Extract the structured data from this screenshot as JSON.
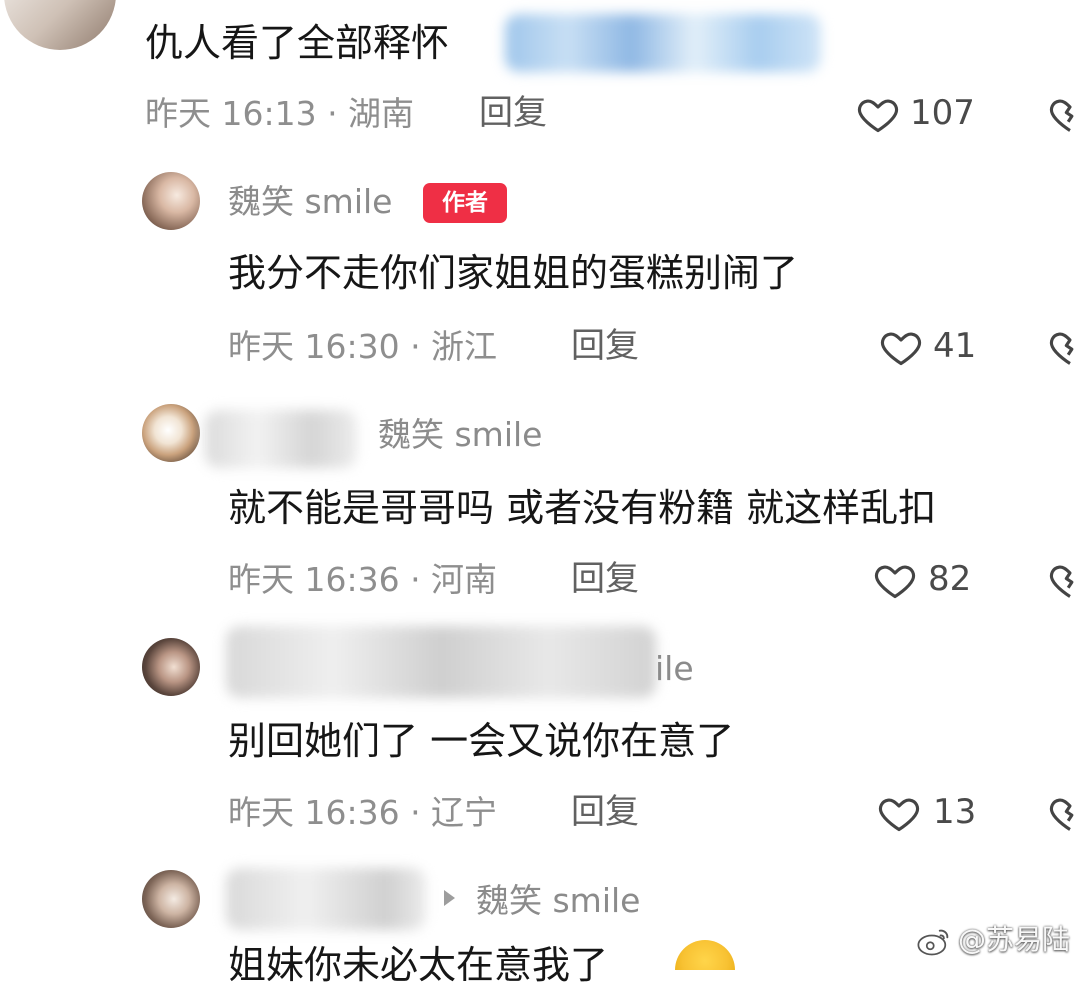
{
  "comments": [
    {
      "avatar_icon": "user-avatar",
      "text": "仇人看了全部释怀",
      "meta": "昨天 16:13 · 湖南",
      "reply": "回复",
      "likes": "107"
    },
    {
      "avatar_icon": "user-avatar",
      "username": "魏笑 smile",
      "badge": "作者",
      "text": "我分不走你们家姐姐的蛋糕别闹了",
      "meta": "昨天 16:30 · 浙江",
      "reply": "回复",
      "likes": "41"
    },
    {
      "avatar_icon": "user-avatar",
      "reply_to": "魏笑 smile",
      "text": "就不能是哥哥吗 或者没有粉籍 就这样乱扣",
      "meta": "昨天 16:36 · 河南",
      "reply": "回复",
      "likes": "82"
    },
    {
      "avatar_icon": "user-avatar",
      "username_partial": "ile",
      "text": "别回她们了 一会又说你在意了",
      "meta": "昨天 16:36 · 辽宁",
      "reply": "回复",
      "likes": "13"
    },
    {
      "avatar_icon": "user-avatar",
      "reply_to": "魏笑 smile",
      "text_partial": "姐妹你未必太在意我了"
    }
  ],
  "watermark": "@苏易陆",
  "colors": {
    "badge": "#ef2f45",
    "text": "#161616",
    "muted": "#8e8e8e"
  }
}
